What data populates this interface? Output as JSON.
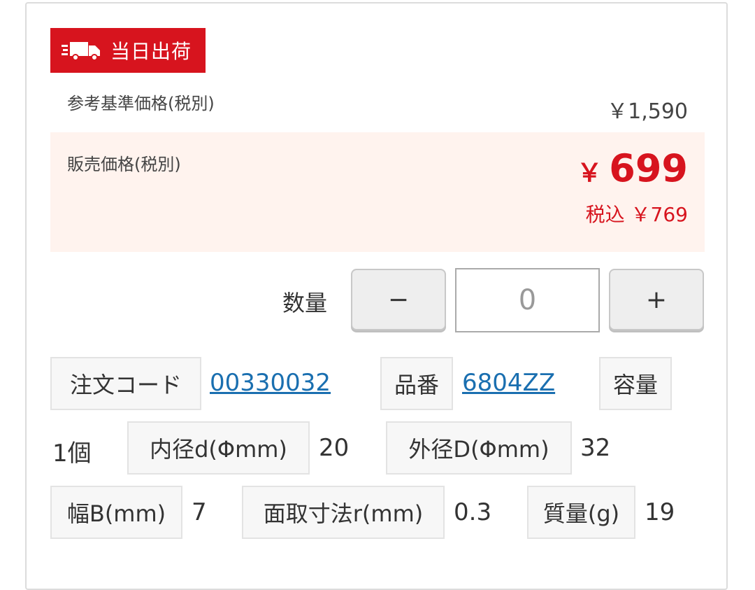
{
  "badge": {
    "label": "当日出荷",
    "icon": "truck-icon",
    "color": "#d7141e"
  },
  "reference_price": {
    "label": "参考基準価格(税別)",
    "value": "￥1,590"
  },
  "sale_price": {
    "label": "販売価格(税別)",
    "currency": "￥",
    "amount": "699",
    "tax_included": "税込 ￥769",
    "color": "#d7141e"
  },
  "quantity": {
    "label": "数量",
    "minus_label": "−",
    "plus_label": "+",
    "value": "0"
  },
  "specs": {
    "order_code": {
      "label": "注文コード",
      "value": "00330032"
    },
    "part_number": {
      "label": "品番",
      "value": "6804ZZ"
    },
    "capacity": {
      "label": "容量",
      "value": "1個"
    },
    "inner_diameter": {
      "label": "内径d(Φmm)",
      "value": "20"
    },
    "outer_diameter": {
      "label": "外径D(Φmm)",
      "value": "32"
    },
    "width": {
      "label": "幅B(mm)",
      "value": "7"
    },
    "chamfer": {
      "label": "面取寸法r(mm)",
      "value": "0.3"
    },
    "mass": {
      "label": "質量(g)",
      "value": "19"
    }
  }
}
